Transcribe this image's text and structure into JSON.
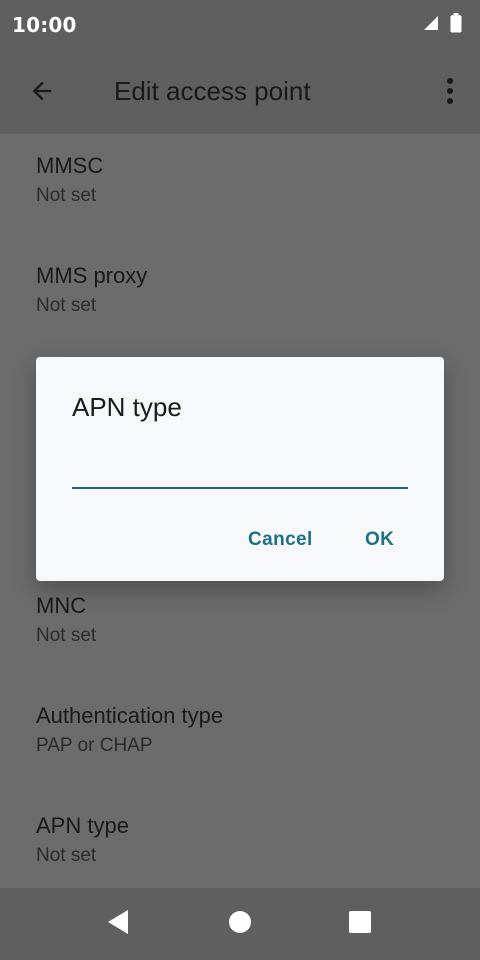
{
  "status_bar": {
    "time": "10:00",
    "icons": [
      "signal-icon",
      "battery-icon"
    ]
  },
  "app_bar": {
    "title": "Edit access point",
    "back_icon": "arrow-back-icon",
    "menu_icon": "more-vertical-icon"
  },
  "list": {
    "items": [
      {
        "title": "MMSC",
        "summary": "Not set"
      },
      {
        "title": "MMS proxy",
        "summary": "Not set"
      },
      {
        "title": "MNC",
        "summary": "Not set"
      },
      {
        "title": "Authentication type",
        "summary": "PAP or CHAP"
      },
      {
        "title": "APN type",
        "summary": "Not set"
      }
    ]
  },
  "dialog": {
    "title": "APN type",
    "input_value": "",
    "cancel_label": "Cancel",
    "ok_label": "OK"
  },
  "nav_bar": {
    "icons": [
      "back-triangle-icon",
      "home-circle-icon",
      "recents-square-icon"
    ]
  },
  "colors": {
    "bar_background": "#5f5f5f",
    "scrim_background": "#6c6c6c",
    "dialog_background": "#f7f8fa",
    "accent": "#1f6f86"
  }
}
